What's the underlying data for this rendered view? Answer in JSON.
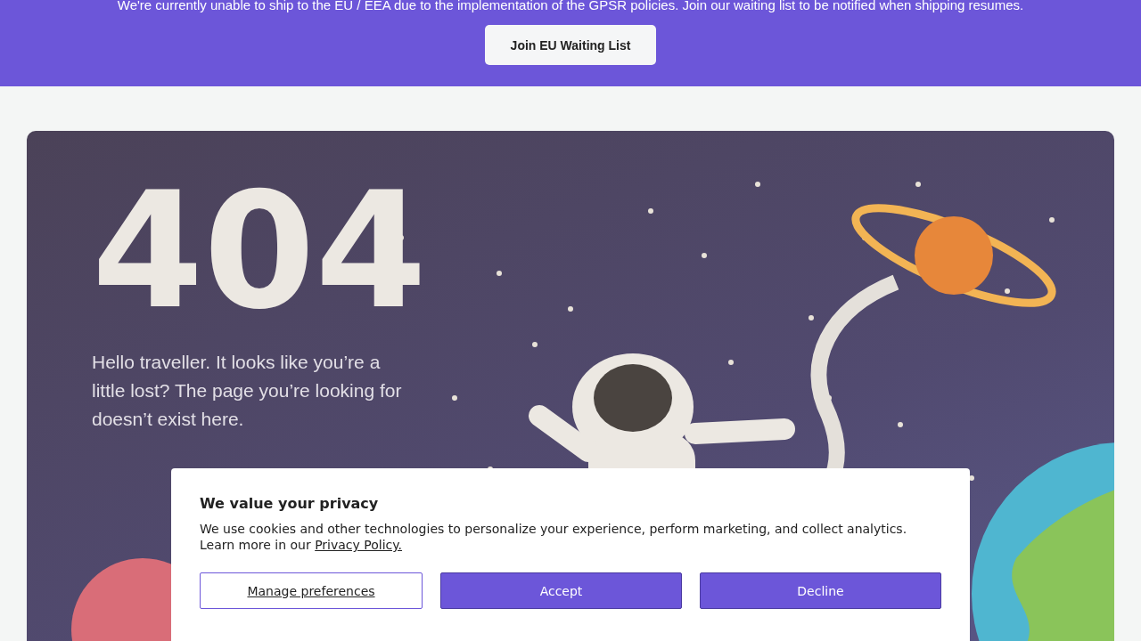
{
  "banner": {
    "message": "We're currently unable to ship to the EU / EEA due to the implementation of the GPSR policies. Join our waiting list to be notified when shipping resumes.",
    "button": "Join EU Waiting List"
  },
  "illustration": {
    "heading": "404",
    "message": "Hello traveller. It looks like you’re a little lost? The page you’re looking for doesn’t exist here."
  },
  "cookie_banner": {
    "title": "We value your privacy",
    "text": "We use cookies and other technologies to personalize your experience, perform marketing, and collect analytics. Learn more in our ",
    "link": "Privacy Policy.",
    "buttons": [
      {
        "label": "Manage preferences",
        "kind": "outline"
      },
      {
        "label": "Accept",
        "kind": "filled"
      },
      {
        "label": "Decline",
        "kind": "filled"
      }
    ]
  }
}
